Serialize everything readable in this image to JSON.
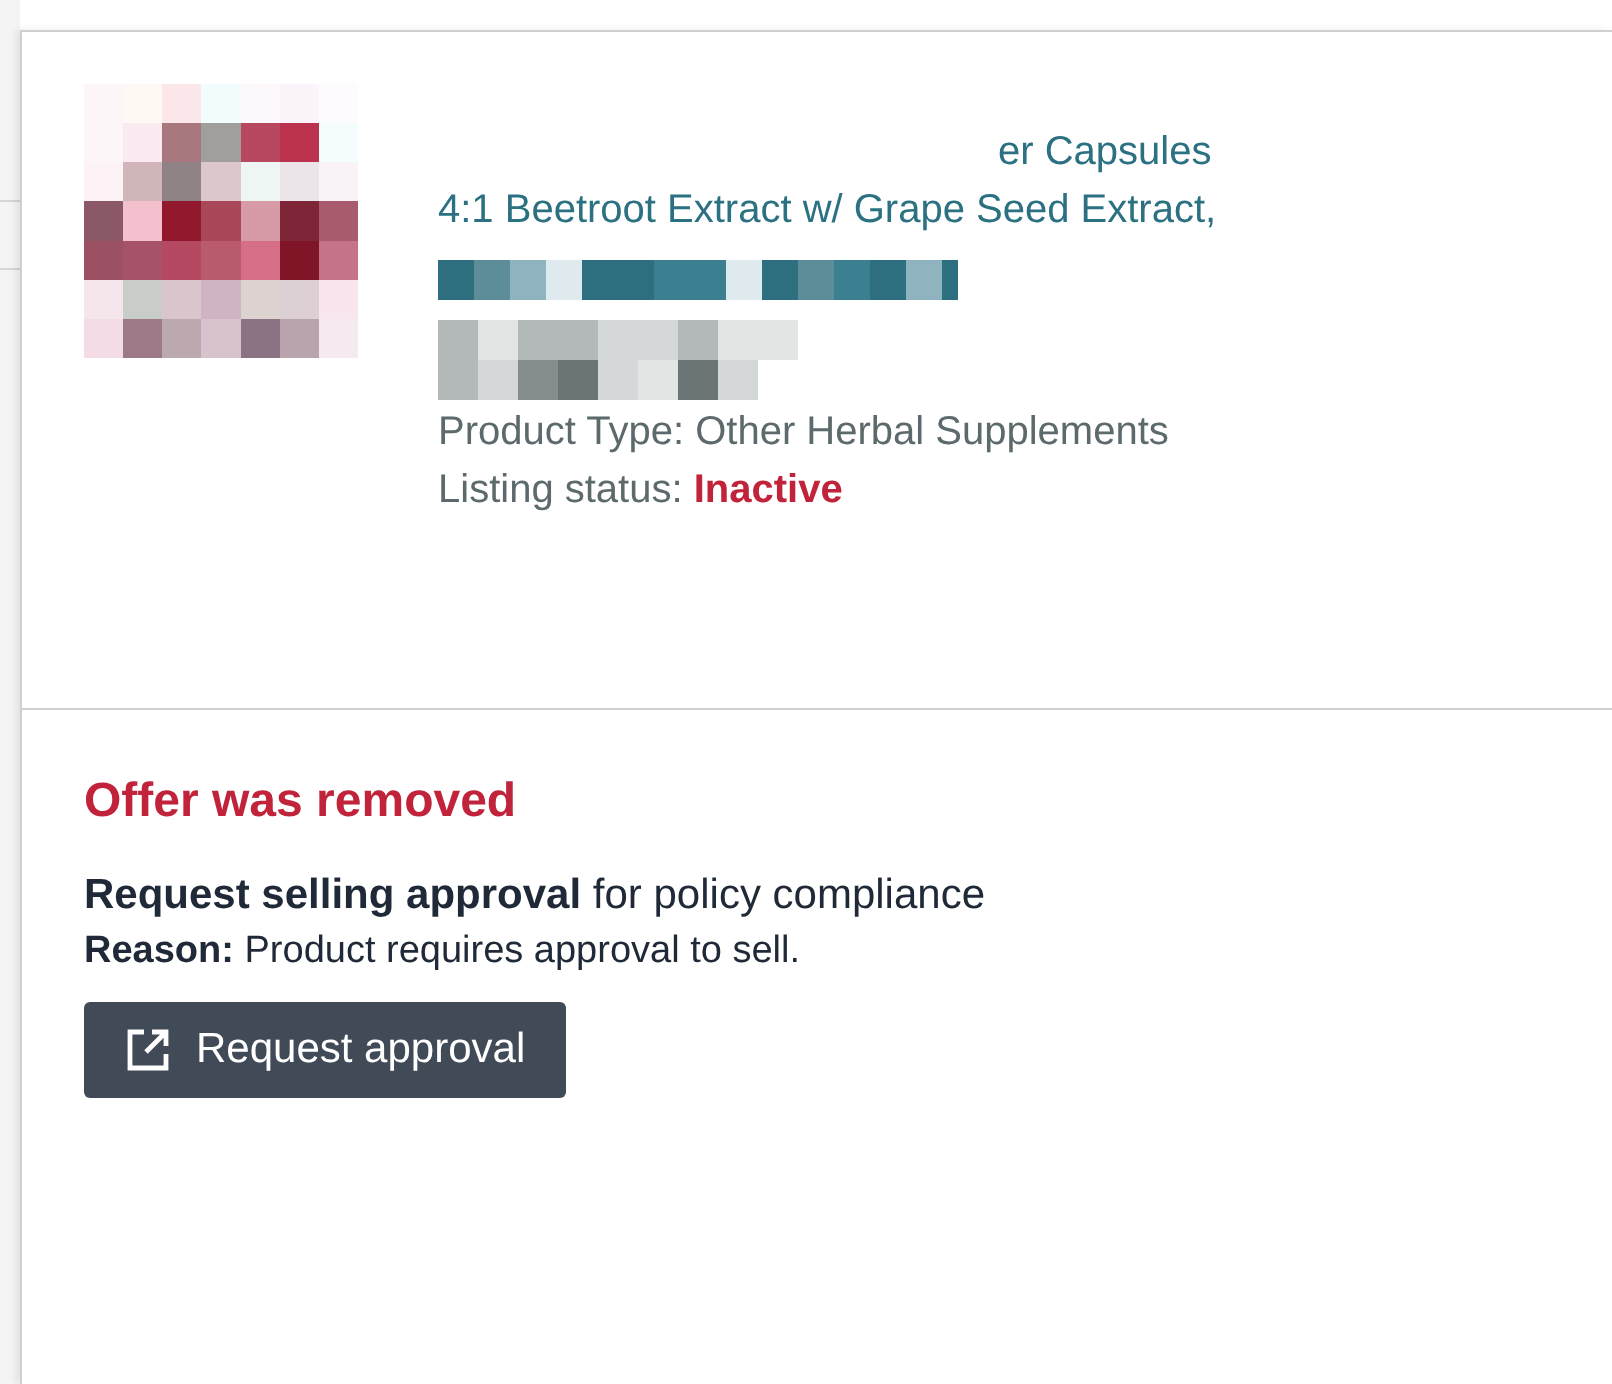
{
  "product": {
    "title_lines": [
      "er Capsules",
      "4:1 Beetroot Extract w/ Grape Seed Extract,"
    ],
    "product_type": "Product Type: Other Herbal Supplements",
    "listing_status": {
      "label": "Listing status:",
      "value": "Inactive",
      "active": false
    }
  },
  "offer": {
    "heading": "Offer was removed",
    "message": "**Request selling approval** for policy compliance",
    "reason": "**Reason:** Product requires approval to sell.",
    "button": "Request approval"
  }
}
